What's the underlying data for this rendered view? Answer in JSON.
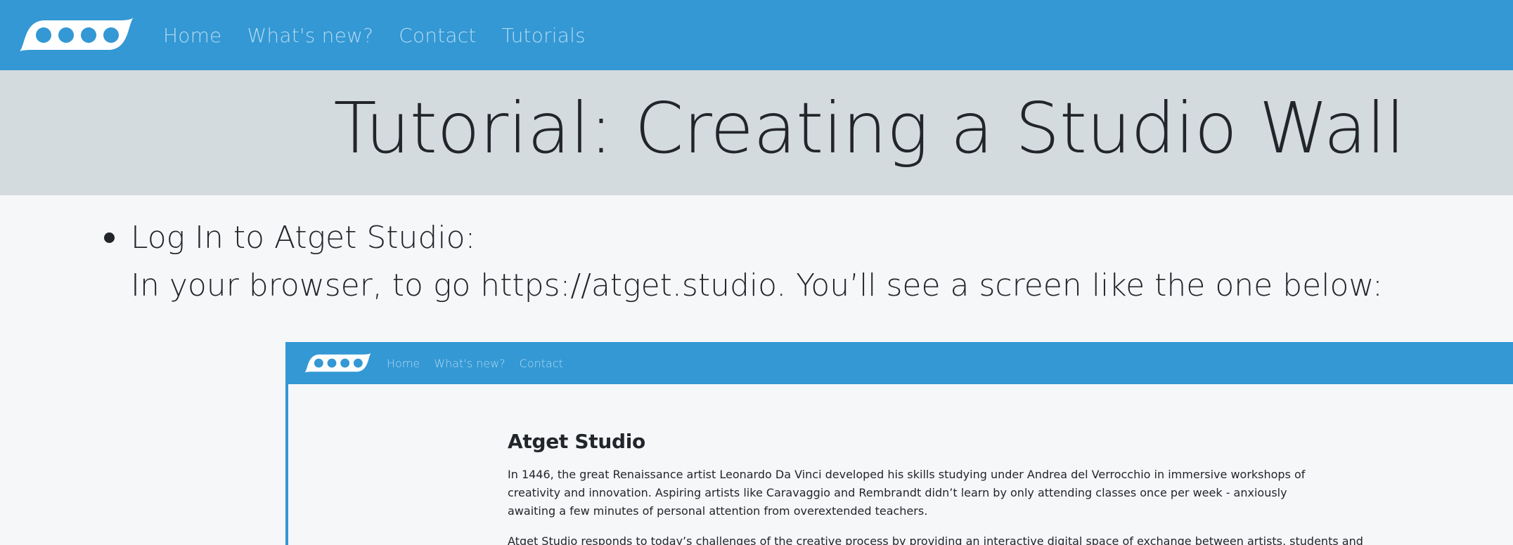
{
  "colors": {
    "nav_bg": "#3398d4",
    "hero_bg": "#d3dbdf",
    "page_bg": "#f6f7f9",
    "link": "#b3d9f1",
    "text": "#22252a"
  },
  "nav": {
    "logo_icon": "four-circles-wave-logo",
    "links": [
      "Home",
      "What's new?",
      "Contact",
      "Tutorials"
    ]
  },
  "hero": {
    "title": "Tutorial: Creating a Studio Wall"
  },
  "steps": [
    {
      "title": "Log In to Atget Studio:",
      "text": "In your browser, to go https://atget.studio. You’ll see a screen like the one below:"
    }
  ],
  "screenshot": {
    "nav_links": [
      "Home",
      "What's new?",
      "Contact"
    ],
    "heading": "Atget Studio",
    "paragraph1": "In 1446, the great Renaissance artist Leonardo Da Vinci developed his skills studying under Andrea del Verrocchio in immersive workshops of creativity and innovation. Aspiring artists like Caravaggio and Rembrandt didn’t learn by only attending classes once per week - anxiously awaiting a few minutes of personal attention from overextended teachers.",
    "paragraph2": "Atget Studio responds to today’s challenges of the creative process by providing an interactive digital space of exchange between artists, students and"
  }
}
